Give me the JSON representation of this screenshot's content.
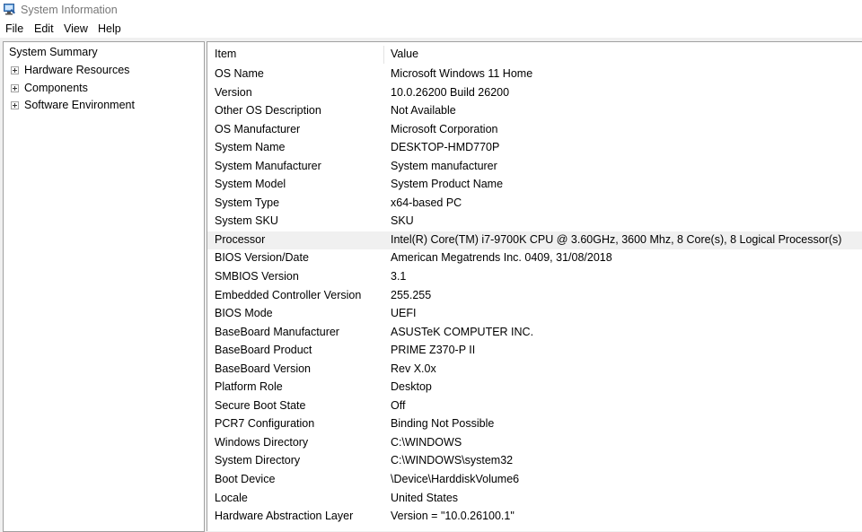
{
  "window": {
    "title": "System Information"
  },
  "menu": [
    "File",
    "Edit",
    "View",
    "Help"
  ],
  "tree": {
    "root": "System Summary",
    "nodes": [
      "Hardware Resources",
      "Components",
      "Software Environment"
    ]
  },
  "table": {
    "headers": {
      "item": "Item",
      "value": "Value"
    },
    "selected_row": 9,
    "rows": [
      {
        "item": "OS Name",
        "value": "Microsoft Windows 11 Home"
      },
      {
        "item": "Version",
        "value": "10.0.26200 Build 26200"
      },
      {
        "item": "Other OS Description",
        "value": "Not Available"
      },
      {
        "item": "OS Manufacturer",
        "value": "Microsoft Corporation"
      },
      {
        "item": "System Name",
        "value": "DESKTOP-HMD770P"
      },
      {
        "item": "System Manufacturer",
        "value": "System manufacturer"
      },
      {
        "item": "System Model",
        "value": "System Product Name"
      },
      {
        "item": "System Type",
        "value": "x64-based PC"
      },
      {
        "item": "System SKU",
        "value": "SKU"
      },
      {
        "item": "Processor",
        "value": "Intel(R) Core(TM) i7-9700K CPU @ 3.60GHz, 3600 Mhz, 8 Core(s), 8 Logical Processor(s)"
      },
      {
        "item": "BIOS Version/Date",
        "value": "American Megatrends Inc. 0409, 31/08/2018"
      },
      {
        "item": "SMBIOS Version",
        "value": "3.1"
      },
      {
        "item": "Embedded Controller Version",
        "value": "255.255"
      },
      {
        "item": "BIOS Mode",
        "value": "UEFI"
      },
      {
        "item": "BaseBoard Manufacturer",
        "value": "ASUSTeK COMPUTER INC."
      },
      {
        "item": "BaseBoard Product",
        "value": "PRIME Z370-P II"
      },
      {
        "item": "BaseBoard Version",
        "value": "Rev X.0x"
      },
      {
        "item": "Platform Role",
        "value": "Desktop"
      },
      {
        "item": "Secure Boot State",
        "value": "Off"
      },
      {
        "item": "PCR7 Configuration",
        "value": "Binding Not Possible"
      },
      {
        "item": "Windows Directory",
        "value": "C:\\WINDOWS"
      },
      {
        "item": "System Directory",
        "value": "C:\\WINDOWS\\system32"
      },
      {
        "item": "Boot Device",
        "value": "\\Device\\HarddiskVolume6"
      },
      {
        "item": "Locale",
        "value": "United States"
      },
      {
        "item": "Hardware Abstraction Layer",
        "value": "Version = \"10.0.26100.1\""
      }
    ]
  }
}
